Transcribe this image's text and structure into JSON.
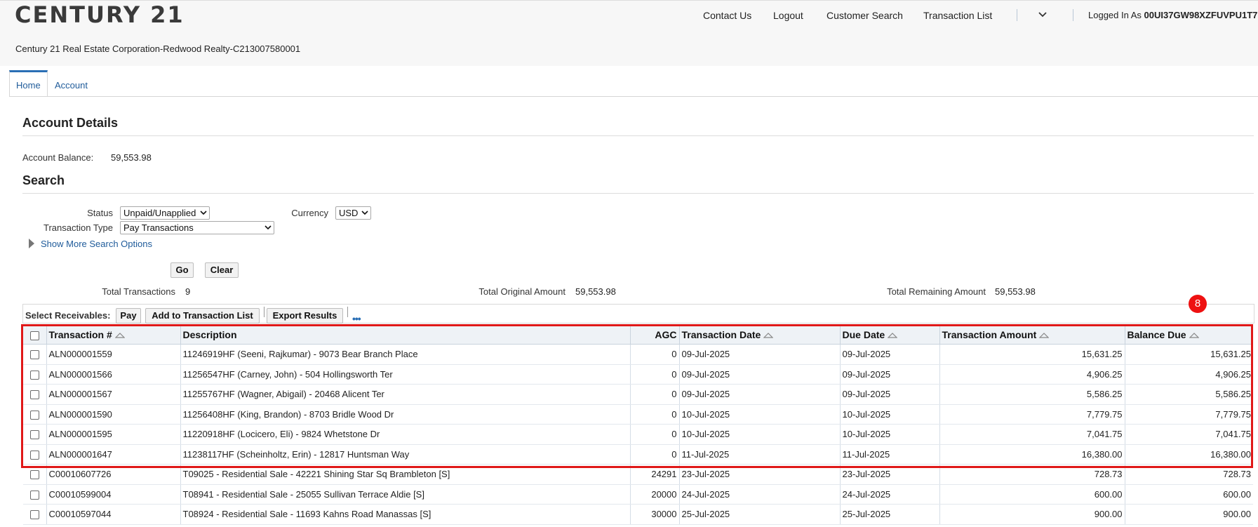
{
  "header": {
    "logo_text": "CENTURY 21",
    "nav": [
      "Contact Us",
      "Logout",
      "Customer Search",
      "Transaction List"
    ],
    "logged_in_label": "Logged In As",
    "logged_in_user": "00UI37GW98XZFUVPU1T7",
    "org_name": "Century 21 Real Estate Corporation-Redwood Realty-C213007580001"
  },
  "tabs": [
    "Home",
    "Account"
  ],
  "account": {
    "title": "Account Details",
    "balance_label": "Account Balance:",
    "balance_value": "59,553.98"
  },
  "search": {
    "title": "Search",
    "status_label": "Status",
    "status_value": "Unpaid/Unapplied",
    "currency_label": "Currency",
    "currency_value": "USD",
    "type_label": "Transaction Type",
    "type_value": "Pay Transactions",
    "more_options": "Show More Search Options",
    "go": "Go",
    "clear": "Clear"
  },
  "totals": {
    "transactions_label": "Total Transactions",
    "transactions_value": "9",
    "original_label": "Total Original Amount",
    "original_value": "59,553.98",
    "remaining_label": "Total Remaining Amount",
    "remaining_value": "59,553.98"
  },
  "toolbar": {
    "select_label": "Select Receivables:",
    "pay": "Pay",
    "add": "Add to Transaction List",
    "export": "Export Results",
    "more": "•••"
  },
  "annotation": {
    "badge": "8",
    "color": "#e01818"
  },
  "table": {
    "columns": [
      "Transaction #",
      "Description",
      "AGC",
      "Transaction Date",
      "Due Date",
      "Transaction Amount",
      "Balance Due"
    ],
    "rows": [
      [
        "ALN000001559",
        "11246919HF (Seeni, Rajkumar) - 9073 Bear Branch Place",
        "0",
        "09-Jul-2025",
        "09-Jul-2025",
        "15,631.25",
        "15,631.25"
      ],
      [
        "ALN000001566",
        "11256547HF (Carney, John) - 504 Hollingsworth Ter",
        "0",
        "09-Jul-2025",
        "09-Jul-2025",
        "4,906.25",
        "4,906.25"
      ],
      [
        "ALN000001567",
        "11255767HF (Wagner, Abigail) - 20468 Alicent Ter",
        "0",
        "09-Jul-2025",
        "09-Jul-2025",
        "5,586.25",
        "5,586.25"
      ],
      [
        "ALN000001590",
        "11256408HF (King, Brandon) - 8703 Bridle Wood Dr",
        "0",
        "10-Jul-2025",
        "10-Jul-2025",
        "7,779.75",
        "7,779.75"
      ],
      [
        "ALN000001595",
        "11220918HF (Locicero, Eli) - 9824 Whetstone Dr",
        "0",
        "10-Jul-2025",
        "10-Jul-2025",
        "7,041.75",
        "7,041.75"
      ],
      [
        "ALN000001647",
        "11238117HF (Scheinholtz, Erin) - 12817 Huntsman Way",
        "0",
        "11-Jul-2025",
        "11-Jul-2025",
        "16,380.00",
        "16,380.00"
      ],
      [
        "C00010607726",
        "T09025 - Residential Sale - 42221 Shining Star Sq Brambleton [S]",
        "24291",
        "23-Jul-2025",
        "23-Jul-2025",
        "728.73",
        "728.73"
      ],
      [
        "C00010599004",
        "T08941 - Residential Sale - 25055 Sullivan Terrace Aldie [S]",
        "20000",
        "24-Jul-2025",
        "24-Jul-2025",
        "600.00",
        "600.00"
      ],
      [
        "C00010597044",
        "T08924 - Residential Sale - 11693 Kahns Road Manassas [S]",
        "30000",
        "25-Jul-2025",
        "25-Jul-2025",
        "900.00",
        "900.00"
      ]
    ]
  }
}
